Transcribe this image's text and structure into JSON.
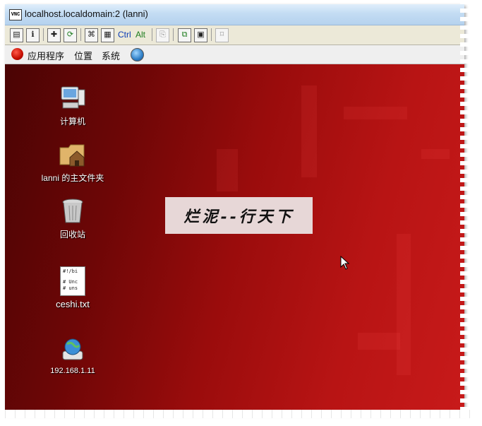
{
  "window": {
    "title": "localhost.localdomain:2 (lanni)",
    "icon_text": "VNC"
  },
  "toolbar": {
    "ctrl_label": "Ctrl",
    "alt_label": "Alt"
  },
  "menubar": {
    "items": [
      "应用程序",
      "位置",
      "系统"
    ]
  },
  "desktop": {
    "icons": [
      {
        "label": "计算机",
        "icon": "computer-icon"
      },
      {
        "label": "lanni 的主文件夹",
        "icon": "home-folder-icon"
      },
      {
        "label": "回收站",
        "icon": "trash-icon"
      },
      {
        "label": "ceshi.txt",
        "icon": "text-file-icon",
        "preview": [
          "#!/bi",
          "# Unc",
          "# uns"
        ]
      },
      {
        "label": "192.168.1.11",
        "icon": "network-drive-icon"
      }
    ],
    "banner": "烂泥--行天下"
  },
  "colors": {
    "desktop_dark": "#4a0404",
    "desktop_light": "#c81a1a",
    "titlebar": "#c3dcf3",
    "banner_bg": "#e7d7d7"
  }
}
